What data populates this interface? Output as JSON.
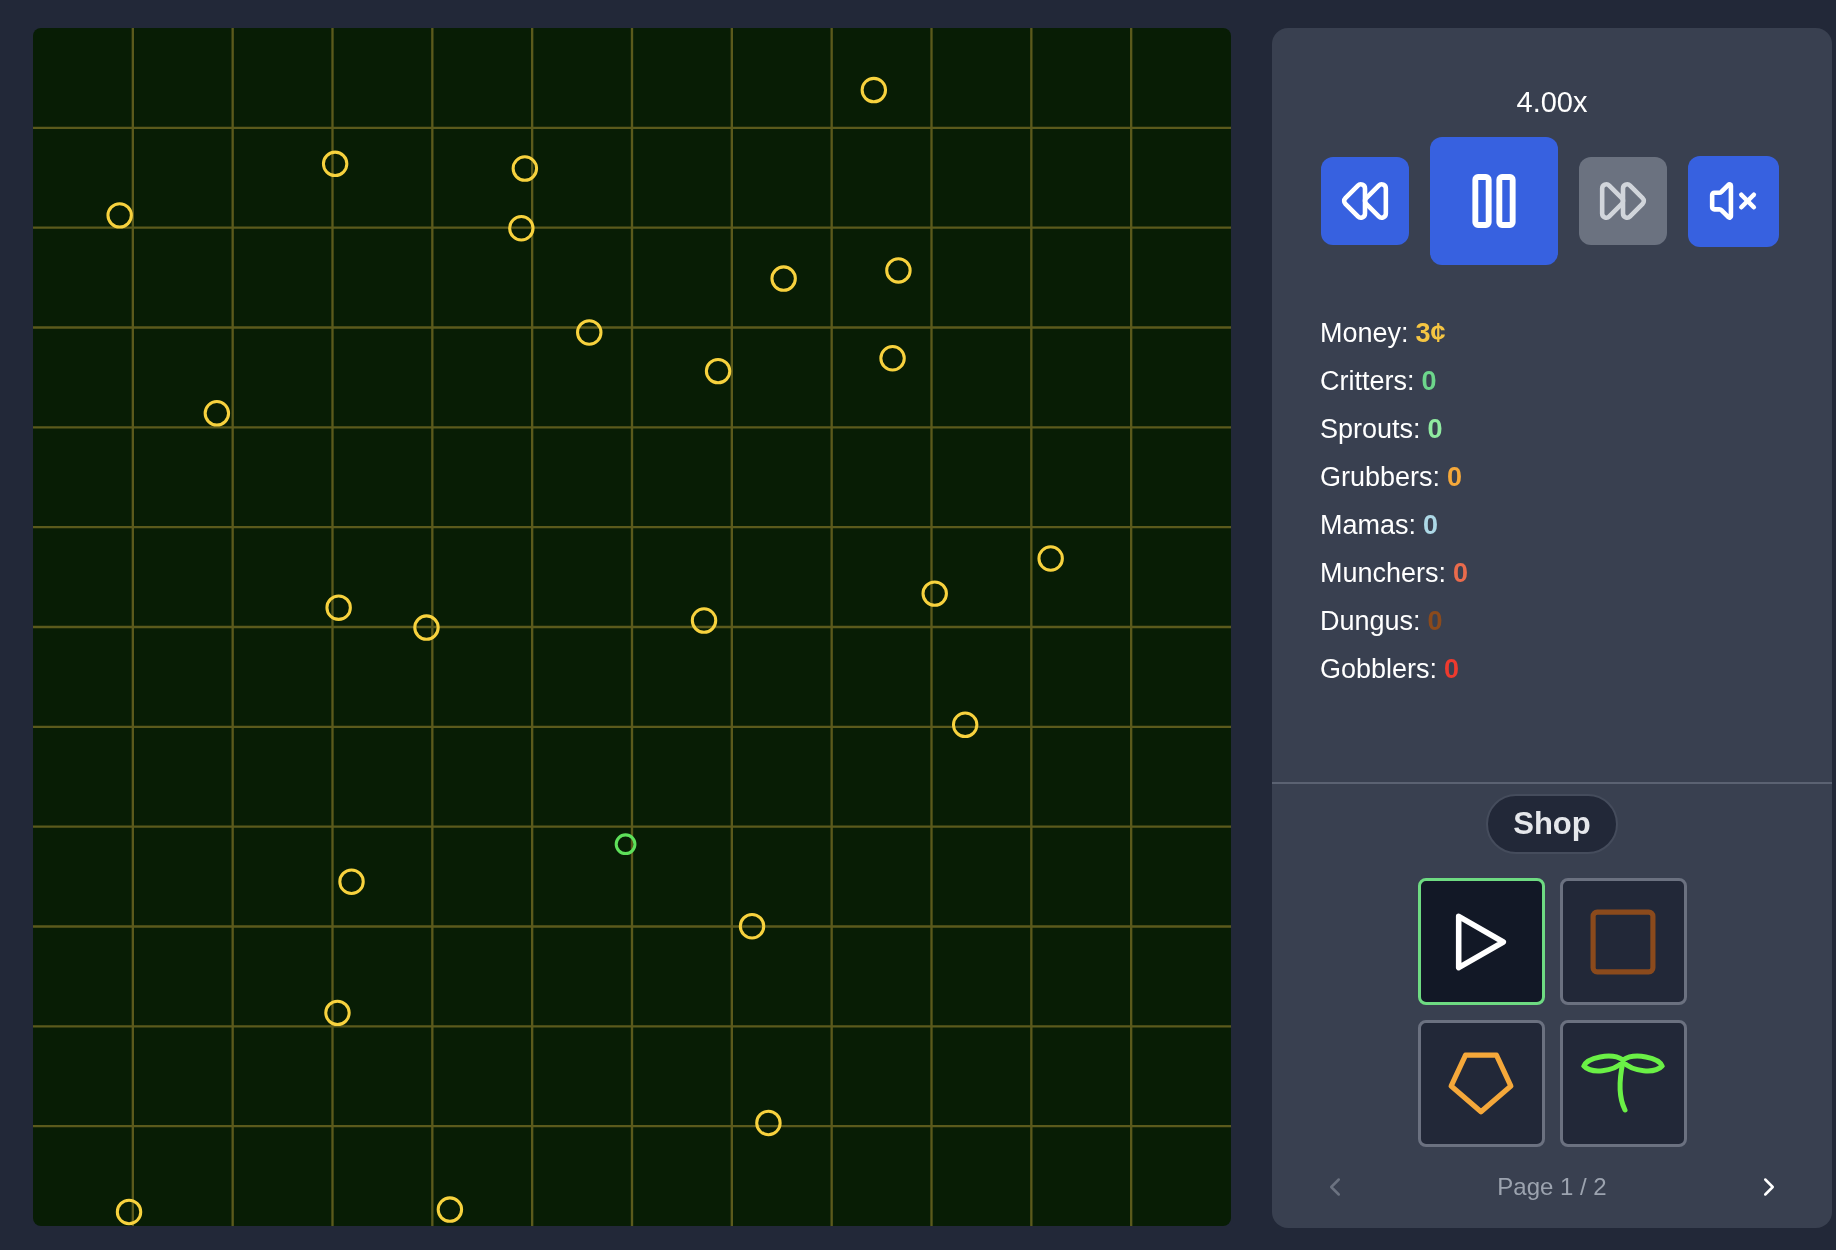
{
  "field": {
    "dots": [
      {
        "color": "#f7d23e"
      },
      {
        "color": "#f7d23e"
      },
      {
        "color": "#f7d23e"
      },
      {
        "color": "#f7d23e"
      },
      {
        "color": "#f7d23e"
      },
      {
        "color": "#f7d23e"
      },
      {
        "color": "#f7d23e"
      },
      {
        "color": "#f7d23e"
      },
      {
        "color": "#f7d23e"
      },
      {
        "color": "#f7d23e"
      },
      {
        "color": "#f7d23e"
      },
      {
        "color": "#f7d23e"
      },
      {
        "color": "#f7d23e"
      },
      {
        "color": "#f7d23e"
      },
      {
        "color": "#f7d23e"
      },
      {
        "color": "#f7d23e"
      },
      {
        "color": "#f7d23e"
      },
      {
        "color": "#5ee05a"
      },
      {
        "color": "#f7d23e"
      },
      {
        "color": "#f7d23e"
      },
      {
        "color": "#f7d23e"
      },
      {
        "color": "#f7d23e"
      },
      {
        "color": "#f7d23e"
      },
      {
        "color": "#f7d23e"
      }
    ]
  },
  "speed": "4.00x",
  "controls": [
    {
      "kind": "rewind",
      "disabled": false
    },
    {
      "kind": "pause",
      "disabled": false
    },
    {
      "kind": "fast_forward",
      "disabled": true
    },
    {
      "kind": "mute",
      "disabled": false
    }
  ],
  "stats": [
    {
      "label": "Money:",
      "value": "3¢",
      "color": "#f5c542"
    },
    {
      "label": "Critters:",
      "value": "0",
      "color": "#6dd68b"
    },
    {
      "label": "Sprouts:",
      "value": "0",
      "color": "#90eaa0"
    },
    {
      "label": "Grubbers:",
      "value": "0",
      "color": "#f5a83a"
    },
    {
      "label": "Mamas:",
      "value": "0",
      "color": "#add8e6"
    },
    {
      "label": "Munchers:",
      "value": "0",
      "color": "#ea6b4c"
    },
    {
      "label": "Dungus:",
      "value": "0",
      "color": "#8b4a1c"
    },
    {
      "label": "Gobblers:",
      "value": "0",
      "color": "#ee3a2e"
    }
  ],
  "shop": {
    "title": "Shop",
    "items": [
      {
        "kind": "triangle",
        "color": "#ffffff",
        "selected": true
      },
      {
        "kind": "square",
        "color": "#8b4a1c",
        "selected": false
      },
      {
        "kind": "pentagon",
        "color": "#f5a83a",
        "selected": false
      },
      {
        "kind": "sprout",
        "color": "#6af046",
        "selected": false
      }
    ],
    "pager": {
      "text": "Page 1 / 2",
      "prev_disabled": true,
      "next_disabled": false
    }
  }
}
